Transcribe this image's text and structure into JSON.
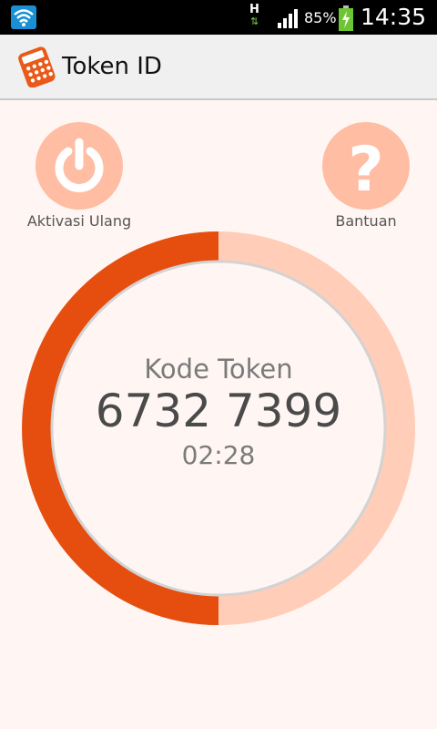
{
  "status_bar": {
    "network_type": "H",
    "battery_percent": "85%",
    "time": "14:35",
    "icons": [
      "wifi-icon",
      "data-transfer-icon",
      "signal-icon",
      "battery-charging-icon"
    ]
  },
  "action_bar": {
    "title": "Token ID",
    "icon": "calculator-app-icon"
  },
  "buttons": {
    "reactivate": {
      "label": "Aktivasi Ulang",
      "icon": "power-icon"
    },
    "help": {
      "label": "Bantuan",
      "icon": "question-mark-icon"
    }
  },
  "token": {
    "label": "Kode Token",
    "code": "6732 7399",
    "time_remaining": "02:28",
    "progress_fraction": 0.5
  },
  "colors": {
    "accent": "#e54e0e",
    "accent_light": "#ffcdb8",
    "button_bg": "#ffbda3",
    "background": "#fff6f3"
  }
}
